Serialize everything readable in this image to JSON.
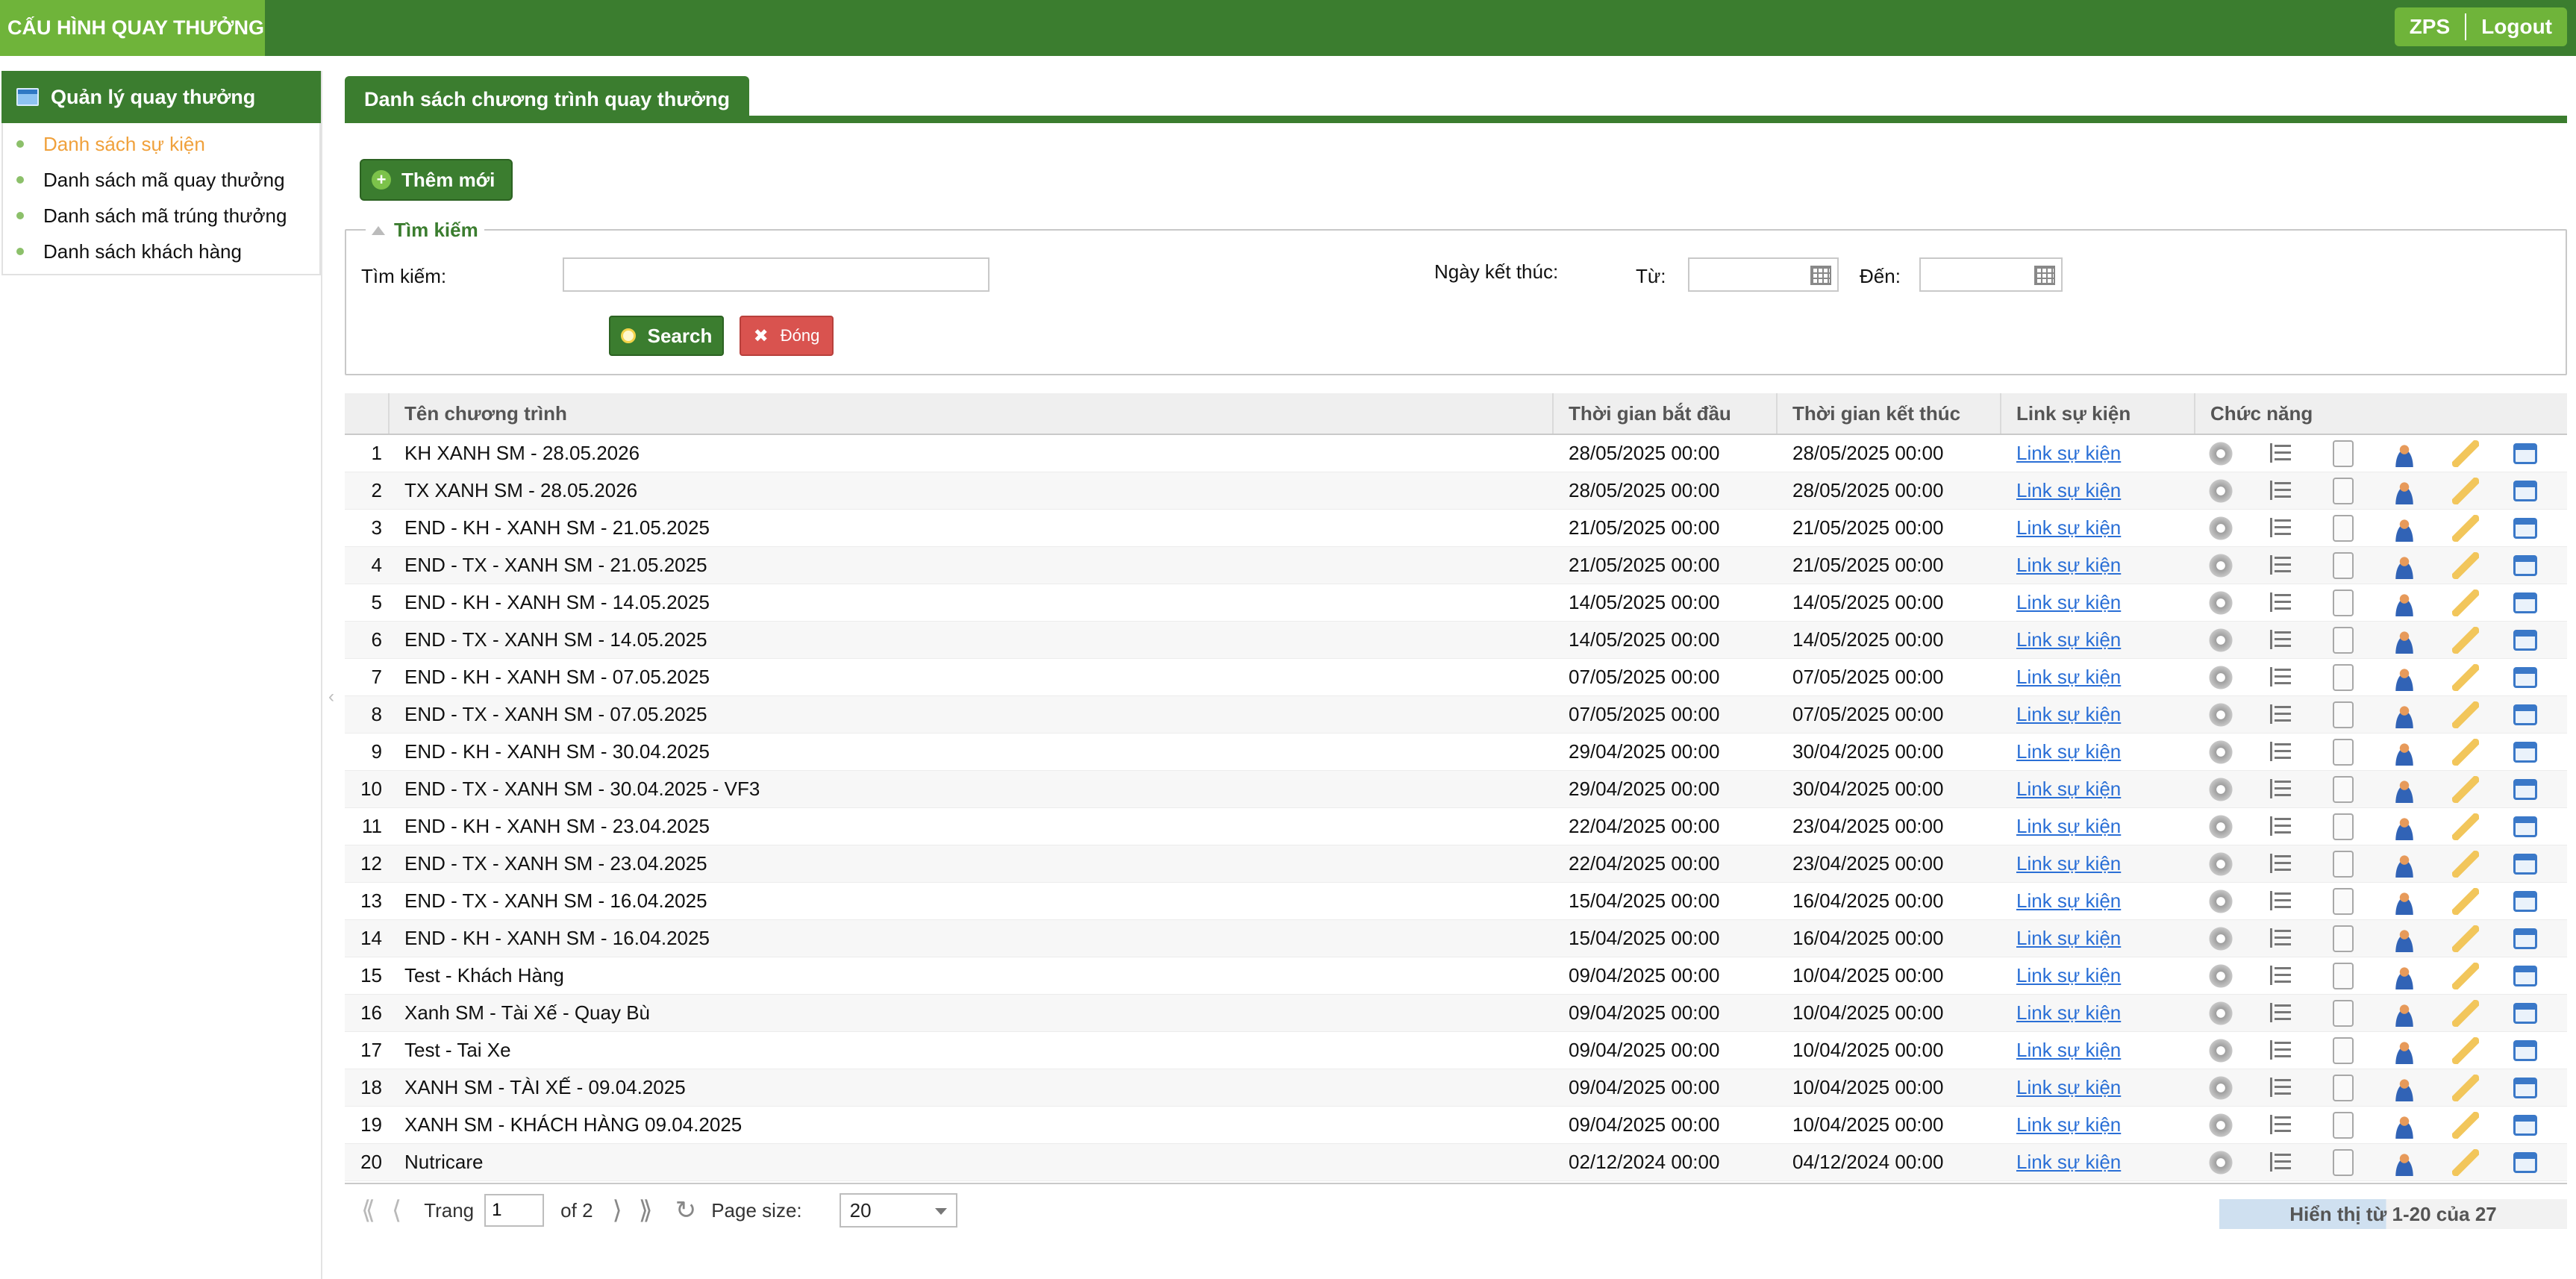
{
  "header": {
    "brand": "CẤU HÌNH QUAY THƯỞNG",
    "user_label": "ZPS",
    "logout_label": "Logout"
  },
  "sidebar": {
    "title": "Quản lý quay thưởng",
    "items": [
      {
        "label": "Danh sách sự kiện",
        "active": true
      },
      {
        "label": "Danh sách mã quay thưởng",
        "active": false
      },
      {
        "label": "Danh sách mã trúng thưởng",
        "active": false
      },
      {
        "label": "Danh sách khách hàng",
        "active": false
      }
    ]
  },
  "main": {
    "tab_label": "Danh sách chương trình quay thưởng",
    "add_label": "Thêm mới",
    "search": {
      "legend": "Tìm kiếm",
      "search_label": "Tìm kiếm:",
      "search_value": "",
      "end_date_label": "Ngày kết thúc:",
      "from_label": "Từ:",
      "to_label": "Đến:",
      "from_value": "",
      "to_value": "",
      "search_button": "Search",
      "close_button": "Đóng"
    }
  },
  "grid": {
    "columns": {
      "name": "Tên chương trình",
      "start": "Thời gian bắt đầu",
      "end": "Thời gian kết thúc",
      "link": "Link sự kiện",
      "actions": "Chức năng"
    },
    "link_text": "Link sự kiện",
    "rows": [
      {
        "num": "1",
        "name": "KH XANH SM - 28.05.2026",
        "start": "28/05/2025 00:00",
        "end": "28/05/2025 00:00"
      },
      {
        "num": "2",
        "name": "TX XANH SM - 28.05.2026",
        "start": "28/05/2025 00:00",
        "end": "28/05/2025 00:00"
      },
      {
        "num": "3",
        "name": "END - KH - XANH SM - 21.05.2025",
        "start": "21/05/2025 00:00",
        "end": "21/05/2025 00:00"
      },
      {
        "num": "4",
        "name": "END - TX - XANH SM - 21.05.2025",
        "start": "21/05/2025 00:00",
        "end": "21/05/2025 00:00"
      },
      {
        "num": "5",
        "name": "END - KH - XANH SM - 14.05.2025",
        "start": "14/05/2025 00:00",
        "end": "14/05/2025 00:00"
      },
      {
        "num": "6",
        "name": "END - TX - XANH SM - 14.05.2025",
        "start": "14/05/2025 00:00",
        "end": "14/05/2025 00:00"
      },
      {
        "num": "7",
        "name": "END - KH - XANH SM - 07.05.2025",
        "start": "07/05/2025 00:00",
        "end": "07/05/2025 00:00"
      },
      {
        "num": "8",
        "name": "END - TX - XANH SM - 07.05.2025",
        "start": "07/05/2025 00:00",
        "end": "07/05/2025 00:00"
      },
      {
        "num": "9",
        "name": "END - KH - XANH SM - 30.04.2025",
        "start": "29/04/2025 00:00",
        "end": "30/04/2025 00:00"
      },
      {
        "num": "10",
        "name": "END - TX - XANH SM - 30.04.2025 - VF3",
        "start": "29/04/2025 00:00",
        "end": "30/04/2025 00:00"
      },
      {
        "num": "11",
        "name": "END - KH - XANH SM - 23.04.2025",
        "start": "22/04/2025 00:00",
        "end": "23/04/2025 00:00"
      },
      {
        "num": "12",
        "name": "END - TX - XANH SM - 23.04.2025",
        "start": "22/04/2025 00:00",
        "end": "23/04/2025 00:00"
      },
      {
        "num": "13",
        "name": "END - TX - XANH SM - 16.04.2025",
        "start": "15/04/2025 00:00",
        "end": "16/04/2025 00:00"
      },
      {
        "num": "14",
        "name": "END - KH - XANH SM - 16.04.2025",
        "start": "15/04/2025 00:00",
        "end": "16/04/2025 00:00"
      },
      {
        "num": "15",
        "name": "Test - Khách Hàng",
        "start": "09/04/2025 00:00",
        "end": "10/04/2025 00:00"
      },
      {
        "num": "16",
        "name": "Xanh SM - Tài Xế - Quay Bù",
        "start": "09/04/2025 00:00",
        "end": "10/04/2025 00:00"
      },
      {
        "num": "17",
        "name": "Test - Tai Xe",
        "start": "09/04/2025 00:00",
        "end": "10/04/2025 00:00"
      },
      {
        "num": "18",
        "name": "XANH SM - TÀI XẾ - 09.04.2025",
        "start": "09/04/2025 00:00",
        "end": "10/04/2025 00:00"
      },
      {
        "num": "19",
        "name": "XANH SM - KHÁCH HÀNG 09.04.2025",
        "start": "09/04/2025 00:00",
        "end": "10/04/2025 00:00"
      },
      {
        "num": "20",
        "name": "Nutricare",
        "start": "02/12/2024 00:00",
        "end": "04/12/2024 00:00"
      }
    ]
  },
  "pager": {
    "page_label": "Trang",
    "page_value": "1",
    "of_label": "of 2",
    "page_size_label": "Page size:",
    "page_size_value": "20",
    "info": "Hiển thị từ 1-20 của 27"
  }
}
